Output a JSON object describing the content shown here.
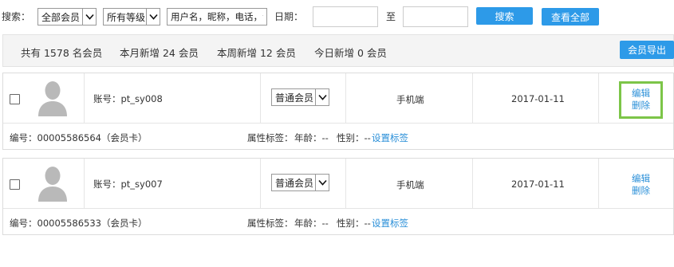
{
  "toolbar": {
    "search_label": "搜索：",
    "member_type": "全部会员",
    "level": "所有等级",
    "keyword_placeholder": "用户名，昵称，电话，会",
    "date_label": "日期：",
    "date_from": "",
    "date_sep": "至",
    "date_to": "",
    "search_button": "搜索",
    "view_all_button": "查看全部"
  },
  "stats": {
    "total": "共有 1578 名会员",
    "month_new": "本月新增 24 会员",
    "week_new": "本周新增 12 会员",
    "today_new": "今日新增 0 会员",
    "export_button": "会员导出"
  },
  "members": [
    {
      "account": "账号：pt_sy008",
      "level": "普通会员",
      "source": "手机端",
      "date": "2017-01-11",
      "edit": "编辑",
      "delete": "删除",
      "card_no": "编号：00005586564（会员卡）",
      "attr_label": "属性标签：",
      "age": "年龄：--",
      "gender": "性别：--",
      "set_tag": "设置标签"
    },
    {
      "account": "账号：pt_sy007",
      "level": "普通会员",
      "source": "手机端",
      "date": "2017-01-11",
      "edit": "编辑",
      "delete": "删除",
      "card_no": "编号：00005586533（会员卡）",
      "attr_label": "属性标签：",
      "age": "年龄：--",
      "gender": "性别：--",
      "set_tag": "设置标签"
    }
  ],
  "colors": {
    "accent_blue": "#2d9ae8",
    "link_blue": "#2a8fd8",
    "highlight_green": "#7cc548",
    "stats_bg": "#f4f4f4"
  },
  "icons": {
    "avatar": "default-user-avatar-icon",
    "dropdown": "chevron-down-icon"
  }
}
